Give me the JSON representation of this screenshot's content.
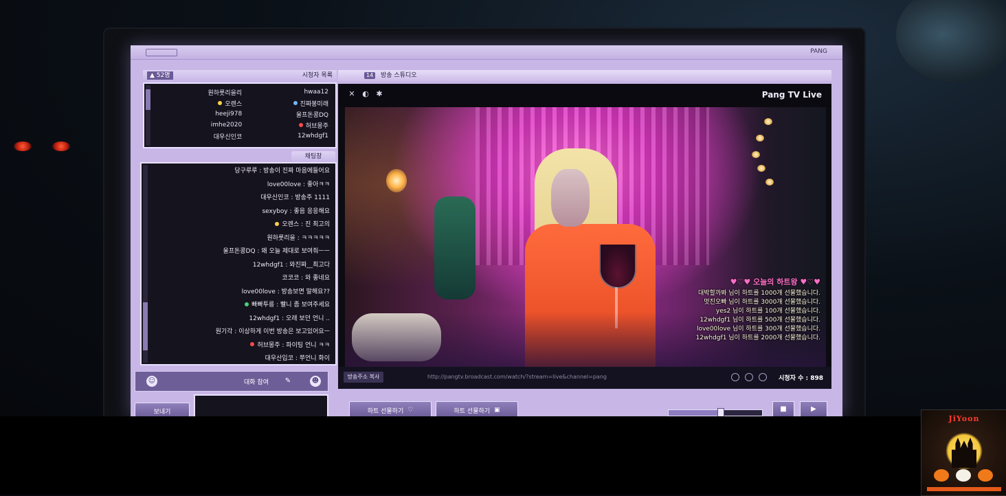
{
  "window": {
    "app_name": "PANG"
  },
  "viewers_panel": {
    "title": "시청자 목록",
    "badge": "▲ 52명",
    "left_column": [
      {
        "name": "hwaa12",
        "dot": ""
      },
      {
        "name": "진짜봉미래",
        "dot": "#6fb6ff"
      },
      {
        "name": "울프돈콩DQ",
        "dot": ""
      },
      {
        "name": "허브몽주",
        "dot": "#ff4a4a"
      },
      {
        "name": "12whdgf1",
        "dot": ""
      }
    ],
    "right_column": [
      {
        "name": "원하룻리을리",
        "dot": ""
      },
      {
        "name": "오렌스",
        "dot": "#ffd24a"
      },
      {
        "name": "heeji978",
        "dot": ""
      },
      {
        "name": "imhe2020",
        "dot": ""
      },
      {
        "name": "대우신인코",
        "dot": ""
      }
    ]
  },
  "chat_panel": {
    "tab": "채팅창",
    "messages": [
      {
        "text": "당구루루 : 방송이 진짜 마음에들어요",
        "dot": ""
      },
      {
        "text": "love00love : 좋아ㅋㅋ",
        "dot": ""
      },
      {
        "text": "대우신인코 : 방송주 1111",
        "dot": ""
      },
      {
        "text": "sexyboy : 좋음 응응해요",
        "dot": ""
      },
      {
        "text": "오렌스 : 진 최고의",
        "dot": "#ffd24a"
      },
      {
        "text": "원하룻리을 : ㅋㅋㅋㅋㅋ",
        "dot": ""
      },
      {
        "text": "울프돈콩DQ : 왜 오늘 제대로 보여줘ㅡㅡ",
        "dot": ""
      },
      {
        "text": "12whdgf1 : 와진짜__최고다",
        "dot": ""
      },
      {
        "text": "코코코 : 와 좋네요",
        "dot": ""
      },
      {
        "text": "love00love : 방송보면 말해요??",
        "dot": ""
      },
      {
        "text": "빠빠투릉 : 빨니 좀 보여주세요",
        "dot": "#4ad07a"
      },
      {
        "text": "12whdgf1 : 오래 보던 언니 ..",
        "dot": ""
      },
      {
        "text": "원기각 : 이상하게 이번 방송은 보고있어요ㅡ",
        "dot": ""
      },
      {
        "text": "허브몽주 : 파이팅 언니 ㅋㅋ",
        "dot": "#ff4a4a"
      },
      {
        "text": "대우산입코 : 쭈언니 화이",
        "dot": ""
      }
    ],
    "input_label": "대화 참여",
    "send_button": "보내기"
  },
  "player": {
    "header_tab": "방송 스튜디오",
    "header_count": "14",
    "title": "Pang TV Live",
    "overlay_header": "♥♡♥ 오늘의 하트왕 ♥♡♥",
    "overlay_rows": [
      "대박할까봐 님이 하트를 1000개 선물했습니다.",
      "멋진오빠 님이 하트를 3000개 선물했습니다.",
      "yes2 님이 하트를 100개 선물했습니다.",
      "12whdgf1 님이 하트를 500개 선물했습니다.",
      "love00love 님이 하트를 300개 선물했습니다.",
      "12whdgf1 님이 하트를 2000개 선물했습니다."
    ],
    "copy_button": "방송주소 복사",
    "url": "http://pangtv.broadcast.com/watch/?stream=live&channel=pang",
    "viewer_count_label": "시청자 수 : 898"
  },
  "controls": {
    "left_button": "하트 선물하기",
    "right_button": "하트 선물하기",
    "volume_level": 0.55
  },
  "channel_badge": {
    "text": "JiYoon"
  },
  "colors": {
    "screen_bg": "#c7b6e6",
    "panel_dark": "#15131d",
    "accent": "#8d7cc0",
    "overlay_header": "#ff6fc8"
  }
}
